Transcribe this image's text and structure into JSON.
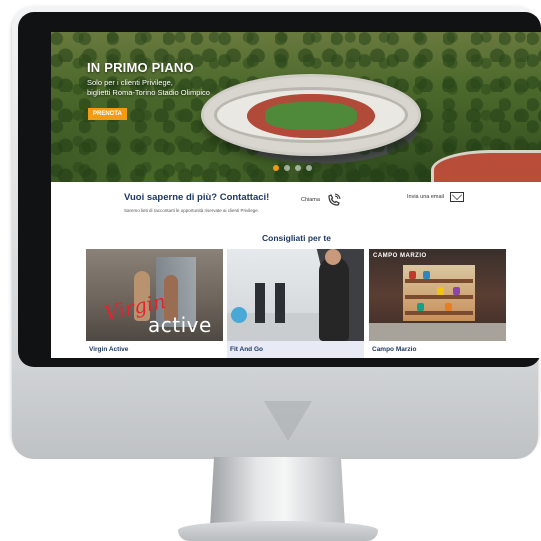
{
  "hero": {
    "title": "IN PRIMO PIANO",
    "subtitle_line1": "Solo per i clienti Privilege,",
    "subtitle_line2": "biglietti Roma-Torino Stadio Olimpico",
    "button": "PRENOTA",
    "carousel_active_index": 0,
    "carousel_count": 4
  },
  "contact": {
    "title": "Vuoi saperne di più? Contattaci!",
    "subtitle": "Saremo lieti di raccontarti le opportunità riservate ai clienti Privilege.",
    "call_label": "Chiama",
    "email_label": "Invia una email"
  },
  "recommended": {
    "title": "Consigliati per te",
    "cards": [
      {
        "label": "Virgin Active",
        "image_text_1": "Virgin",
        "image_text_2": "active"
      },
      {
        "label": "Fit And Go"
      },
      {
        "label": "Campo Marzio",
        "image_text": "CAMPO MARZIO"
      }
    ]
  },
  "colors": {
    "accent": "#f39c12",
    "heading": "#1f3864"
  },
  "icons": [
    "phone-icon",
    "mail-icon"
  ]
}
